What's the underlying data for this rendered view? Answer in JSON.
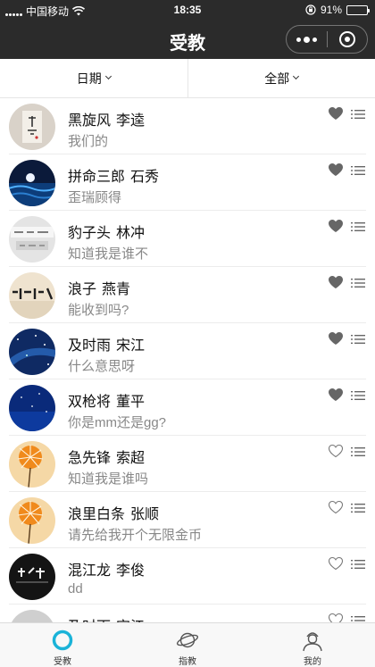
{
  "status_bar": {
    "carrier": "中国移动",
    "time": "18:35",
    "battery": "91%",
    "battery_level": 0.91
  },
  "nav": {
    "title": "受教"
  },
  "filters": {
    "date_label": "日期",
    "category_label": "全部"
  },
  "list": [
    {
      "nick": "黑旋风",
      "name": "李逵",
      "message": "我们的",
      "liked": true,
      "avatar": "calligraphy-card"
    },
    {
      "nick": "拼命三郎",
      "name": "石秀",
      "message": "歪瑞顾得",
      "liked": true,
      "avatar": "night-sea-moon"
    },
    {
      "nick": "豹子头",
      "name": "林冲",
      "message": "知道我是谁不",
      "liked": true,
      "avatar": "grey-signboard"
    },
    {
      "nick": "浪子",
      "name": "燕青",
      "message": "能收到吗?",
      "liked": true,
      "avatar": "ink-text-beige"
    },
    {
      "nick": "及时雨",
      "name": "宋江",
      "message": "什么意思呀",
      "liked": true,
      "avatar": "blue-starry-sky"
    },
    {
      "nick": "双枪将",
      "name": "董平",
      "message": "你是mm还是gg?",
      "liked": true,
      "avatar": "deep-blue-sky"
    },
    {
      "nick": "急先锋",
      "name": "索超",
      "message": "知道我是谁吗",
      "liked": false,
      "avatar": "orange-dandelion"
    },
    {
      "nick": "浪里白条",
      "name": "张顺",
      "message": "请先给我开个无限金币",
      "liked": false,
      "avatar": "orange-dandelion"
    },
    {
      "nick": "混江龙",
      "name": "李俊",
      "message": "dd",
      "liked": false,
      "avatar": "black-calligraphy"
    },
    {
      "nick": "及时雨",
      "name": "宋江",
      "message": "",
      "liked": false,
      "avatar": "grey-placeholder"
    }
  ],
  "tabs": [
    {
      "label": "受教",
      "icon": "ring-icon",
      "active": true
    },
    {
      "label": "指教",
      "icon": "planet-icon",
      "active": false
    },
    {
      "label": "我的",
      "icon": "user-icon",
      "active": false
    }
  ],
  "colors": {
    "header_bg": "#2b2b2b",
    "accent": "#1ab3d8",
    "heart": "#666666",
    "text_secondary": "#888888"
  }
}
